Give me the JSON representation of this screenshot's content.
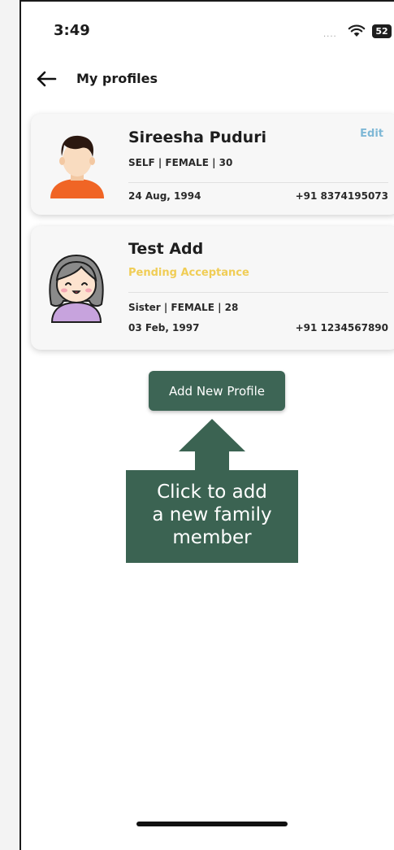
{
  "status_bar": {
    "time": "3:49",
    "signal": "....",
    "battery": "52"
  },
  "header": {
    "title": "My profiles"
  },
  "profiles": [
    {
      "name": "Sireesha Puduri",
      "relation_line": "SELF | FEMALE | 30",
      "edit_label": "Edit",
      "dob": "24 Aug, 1994",
      "phone": "+91 8374195073"
    },
    {
      "name": "Test Add",
      "status": "Pending Acceptance",
      "relation_line": "Sister | FEMALE | 28",
      "dob": "03 Feb, 1997",
      "phone": "+91 1234567890"
    }
  ],
  "actions": {
    "add_profile_label": "Add New Profile"
  },
  "callout": {
    "line1": "Click to add",
    "line2": "a new family",
    "line3": "member"
  },
  "colors": {
    "primary": "#3d6555",
    "edit": "#7fb8d6",
    "pending": "#f0cd56"
  }
}
